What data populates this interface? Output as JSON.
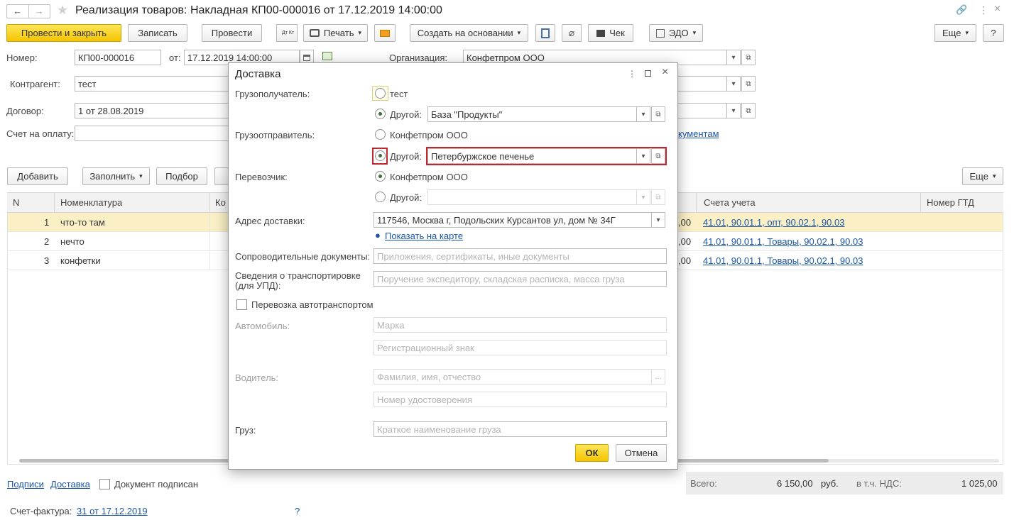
{
  "window": {
    "title": "Реализация товаров: Накладная КП00-000016 от 17.12.2019 14:00:00",
    "back": "←",
    "forward": "→",
    "star": "★",
    "link_icon": "🔗",
    "more_icon": "⋮",
    "close_icon": "×"
  },
  "toolbar": {
    "post_close": "Провести и закрыть",
    "save": "Записать",
    "post": "Провести",
    "dtkt": "Дт Кт",
    "print": "Печать",
    "create_basis": "Создать на основании",
    "check": "Чек",
    "edo": "ЭДО",
    "more": "Еще",
    "help": "?"
  },
  "form": {
    "number_label": "Номер:",
    "number_value": "КП00-000016",
    "date_label": "от:",
    "date_value": "17.12.2019 14:00:00",
    "org_label": "Организация:",
    "org_value": "Конфетпром ООО",
    "contractor_label": "Контрагент:",
    "contractor_value": "тест",
    "contract_label": "Договор:",
    "contract_value": "1 от 28.08.2019",
    "invoice_label": "Счет на оплату:",
    "docs_link": "кументам"
  },
  "table_toolbar": {
    "add": "Добавить",
    "fill": "Заполнить",
    "select": "Подбор",
    "more": "Еще"
  },
  "table": {
    "headers": {
      "n": "N",
      "nomenclature": "Номенклатура",
      "qty": "Ко",
      "accounts": "Счета учета",
      "gtd": "Номер ГТД"
    },
    "rows": [
      {
        "n": "1",
        "name": "что-то там",
        "amount": ",00",
        "accounts": "41.01, 90.01.1, опт, 90.02.1, 90.03"
      },
      {
        "n": "2",
        "name": "нечто",
        "amount": ",00",
        "accounts": "41.01, 90.01.1, Товары, 90.02.1, 90.03"
      },
      {
        "n": "3",
        "name": "конфетки",
        "amount": ",00",
        "accounts": "41.01, 90.01.1, Товары, 90.02.1, 90.03"
      }
    ]
  },
  "footer": {
    "signatures": "Подписи",
    "delivery": "Доставка",
    "signed": "Документ подписан",
    "total_label": "Всего:",
    "total_value": "6 150,00",
    "currency": "руб.",
    "vat_label": "в т.ч. НДС:",
    "vat_value": "1 025,00",
    "invoice_label": "Счет-фактура:",
    "invoice_link": "31 от 17.12.2019",
    "help": "?"
  },
  "dialog": {
    "title": "Доставка",
    "consignee_label": "Грузополучатель:",
    "consignee_option1": "тест",
    "other_label": "Другой:",
    "consignee_other_value": "База \"Продукты\"",
    "shipper_label": "Грузоотправитель:",
    "shipper_option1": "Конфетпром ООО",
    "shipper_other_value": "Петербуржское печенье",
    "carrier_label": "Перевозчик:",
    "carrier_option1": "Конфетпром ООО",
    "address_label": "Адрес доставки:",
    "address_value": "117546, Москва г, Подольских Курсантов ул, дом № 34Г",
    "show_on_map": "Показать на карте",
    "docs_label": "Сопроводительные документы:",
    "docs_placeholder": "Приложения, сертификаты, иные документы",
    "transport_label": "Сведения о транспортировке (для УПД):",
    "transport_placeholder": "Поручение экспедитору, складская расписка, масса груза",
    "auto_transport": "Перевозка автотранспортом",
    "car_label": "Автомобиль:",
    "car_brand_placeholder": "Марка",
    "car_reg_placeholder": "Регистрационный знак",
    "driver_label": "Водитель:",
    "driver_name_placeholder": "Фамилия, имя, отчество",
    "driver_license_placeholder": "Номер удостоверения",
    "cargo_label": "Груз:",
    "cargo_placeholder": "Краткое наименование груза",
    "ok": "ОК",
    "cancel": "Отмена"
  }
}
